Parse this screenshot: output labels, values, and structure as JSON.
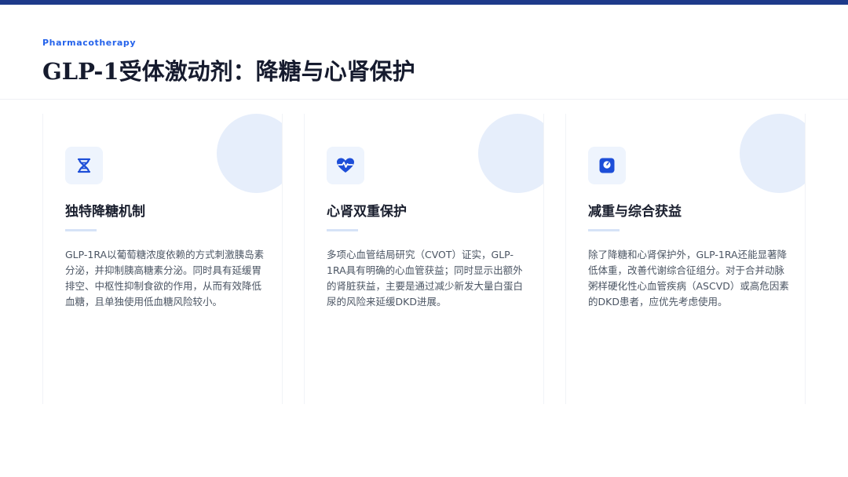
{
  "header": {
    "eyebrow": "Pharmacotherapy",
    "title": "GLP-1受体激动剂：降糖与心肾保护"
  },
  "colors": {
    "accent": "#2563eb",
    "top_bar": "#1e3a8a",
    "icon_bg": "#eef4fd",
    "circle": "#e6eefb"
  },
  "cards": [
    {
      "icon": "dna-icon",
      "title": "独特降糖机制",
      "text": "GLP-1RA以葡萄糖浓度依赖的方式刺激胰岛素分泌，并抑制胰高糖素分泌。同时具有延缓胃排空、中枢性抑制食欲的作用，从而有效降低血糖，且单独使用低血糖风险较小。"
    },
    {
      "icon": "heart-pulse-icon",
      "title": "心肾双重保护",
      "text": "多项心血管结局研究（CVOT）证实，GLP-1RA具有明确的心血管获益；同时显示出额外的肾脏获益，主要是通过减少新发大量白蛋白尿的风险来延缓DKD进展。"
    },
    {
      "icon": "weight-scale-icon",
      "title": "减重与综合获益",
      "text": "除了降糖和心肾保护外，GLP-1RA还能显著降低体重，改善代谢综合征组分。对于合并动脉粥样硬化性心血管疾病（ASCVD）或高危因素的DKD患者，应优先考虑使用。"
    }
  ]
}
